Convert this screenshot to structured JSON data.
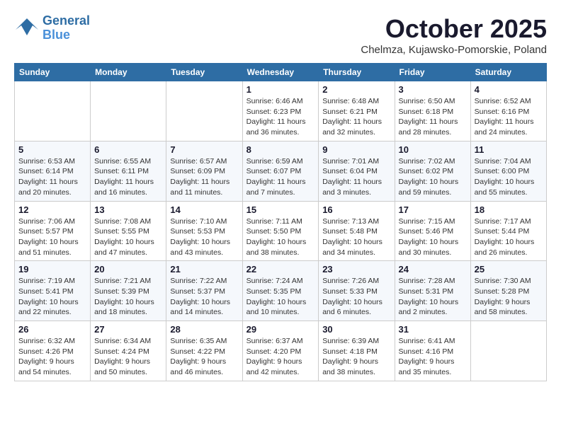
{
  "logo": {
    "line1": "General",
    "line2": "Blue"
  },
  "title": "October 2025",
  "subtitle": "Chelmza, Kujawsko-Pomorskie, Poland",
  "weekdays": [
    "Sunday",
    "Monday",
    "Tuesday",
    "Wednesday",
    "Thursday",
    "Friday",
    "Saturday"
  ],
  "rows": [
    [
      {
        "day": "",
        "info": ""
      },
      {
        "day": "",
        "info": ""
      },
      {
        "day": "",
        "info": ""
      },
      {
        "day": "1",
        "info": "Sunrise: 6:46 AM\nSunset: 6:23 PM\nDaylight: 11 hours\nand 36 minutes."
      },
      {
        "day": "2",
        "info": "Sunrise: 6:48 AM\nSunset: 6:21 PM\nDaylight: 11 hours\nand 32 minutes."
      },
      {
        "day": "3",
        "info": "Sunrise: 6:50 AM\nSunset: 6:18 PM\nDaylight: 11 hours\nand 28 minutes."
      },
      {
        "day": "4",
        "info": "Sunrise: 6:52 AM\nSunset: 6:16 PM\nDaylight: 11 hours\nand 24 minutes."
      }
    ],
    [
      {
        "day": "5",
        "info": "Sunrise: 6:53 AM\nSunset: 6:14 PM\nDaylight: 11 hours\nand 20 minutes."
      },
      {
        "day": "6",
        "info": "Sunrise: 6:55 AM\nSunset: 6:11 PM\nDaylight: 11 hours\nand 16 minutes."
      },
      {
        "day": "7",
        "info": "Sunrise: 6:57 AM\nSunset: 6:09 PM\nDaylight: 11 hours\nand 11 minutes."
      },
      {
        "day": "8",
        "info": "Sunrise: 6:59 AM\nSunset: 6:07 PM\nDaylight: 11 hours\nand 7 minutes."
      },
      {
        "day": "9",
        "info": "Sunrise: 7:01 AM\nSunset: 6:04 PM\nDaylight: 11 hours\nand 3 minutes."
      },
      {
        "day": "10",
        "info": "Sunrise: 7:02 AM\nSunset: 6:02 PM\nDaylight: 10 hours\nand 59 minutes."
      },
      {
        "day": "11",
        "info": "Sunrise: 7:04 AM\nSunset: 6:00 PM\nDaylight: 10 hours\nand 55 minutes."
      }
    ],
    [
      {
        "day": "12",
        "info": "Sunrise: 7:06 AM\nSunset: 5:57 PM\nDaylight: 10 hours\nand 51 minutes."
      },
      {
        "day": "13",
        "info": "Sunrise: 7:08 AM\nSunset: 5:55 PM\nDaylight: 10 hours\nand 47 minutes."
      },
      {
        "day": "14",
        "info": "Sunrise: 7:10 AM\nSunset: 5:53 PM\nDaylight: 10 hours\nand 43 minutes."
      },
      {
        "day": "15",
        "info": "Sunrise: 7:11 AM\nSunset: 5:50 PM\nDaylight: 10 hours\nand 38 minutes."
      },
      {
        "day": "16",
        "info": "Sunrise: 7:13 AM\nSunset: 5:48 PM\nDaylight: 10 hours\nand 34 minutes."
      },
      {
        "day": "17",
        "info": "Sunrise: 7:15 AM\nSunset: 5:46 PM\nDaylight: 10 hours\nand 30 minutes."
      },
      {
        "day": "18",
        "info": "Sunrise: 7:17 AM\nSunset: 5:44 PM\nDaylight: 10 hours\nand 26 minutes."
      }
    ],
    [
      {
        "day": "19",
        "info": "Sunrise: 7:19 AM\nSunset: 5:41 PM\nDaylight: 10 hours\nand 22 minutes."
      },
      {
        "day": "20",
        "info": "Sunrise: 7:21 AM\nSunset: 5:39 PM\nDaylight: 10 hours\nand 18 minutes."
      },
      {
        "day": "21",
        "info": "Sunrise: 7:22 AM\nSunset: 5:37 PM\nDaylight: 10 hours\nand 14 minutes."
      },
      {
        "day": "22",
        "info": "Sunrise: 7:24 AM\nSunset: 5:35 PM\nDaylight: 10 hours\nand 10 minutes."
      },
      {
        "day": "23",
        "info": "Sunrise: 7:26 AM\nSunset: 5:33 PM\nDaylight: 10 hours\nand 6 minutes."
      },
      {
        "day": "24",
        "info": "Sunrise: 7:28 AM\nSunset: 5:31 PM\nDaylight: 10 hours\nand 2 minutes."
      },
      {
        "day": "25",
        "info": "Sunrise: 7:30 AM\nSunset: 5:28 PM\nDaylight: 9 hours\nand 58 minutes."
      }
    ],
    [
      {
        "day": "26",
        "info": "Sunrise: 6:32 AM\nSunset: 4:26 PM\nDaylight: 9 hours\nand 54 minutes."
      },
      {
        "day": "27",
        "info": "Sunrise: 6:34 AM\nSunset: 4:24 PM\nDaylight: 9 hours\nand 50 minutes."
      },
      {
        "day": "28",
        "info": "Sunrise: 6:35 AM\nSunset: 4:22 PM\nDaylight: 9 hours\nand 46 minutes."
      },
      {
        "day": "29",
        "info": "Sunrise: 6:37 AM\nSunset: 4:20 PM\nDaylight: 9 hours\nand 42 minutes."
      },
      {
        "day": "30",
        "info": "Sunrise: 6:39 AM\nSunset: 4:18 PM\nDaylight: 9 hours\nand 38 minutes."
      },
      {
        "day": "31",
        "info": "Sunrise: 6:41 AM\nSunset: 4:16 PM\nDaylight: 9 hours\nand 35 minutes."
      },
      {
        "day": "",
        "info": ""
      }
    ]
  ]
}
